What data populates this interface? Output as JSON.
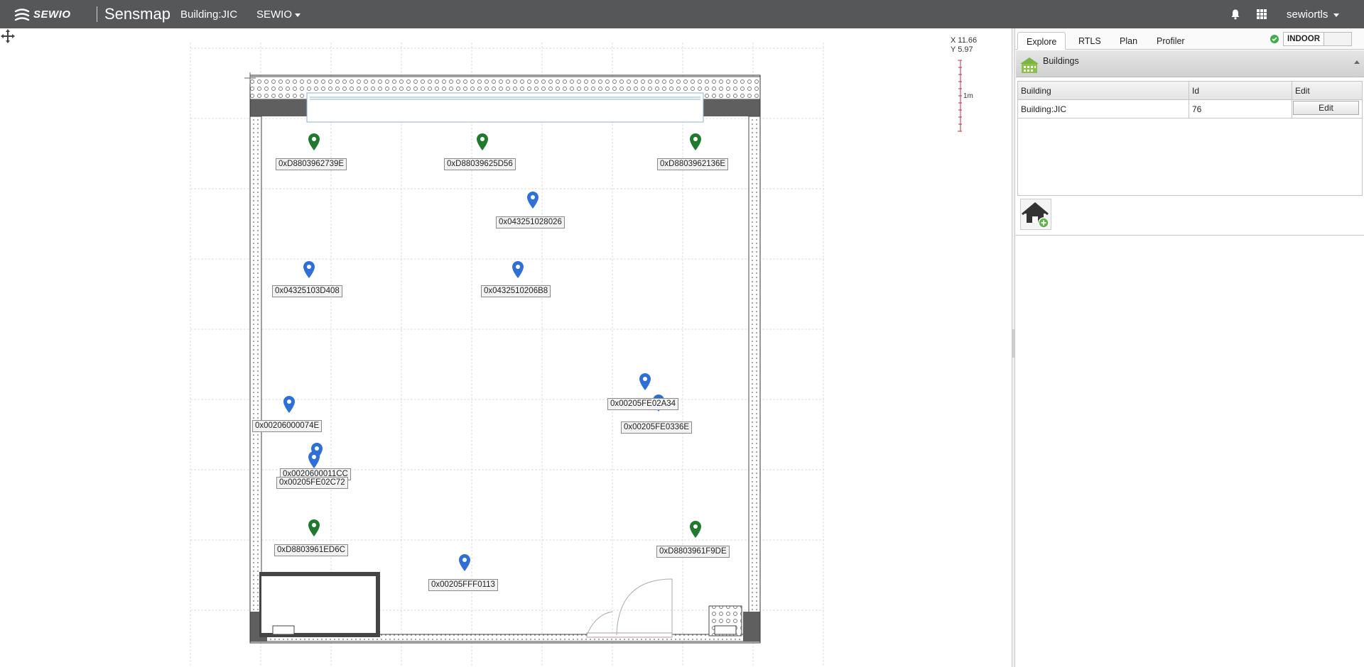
{
  "header": {
    "logo_text": "SEWIO",
    "app_name": "Sensmap",
    "building": "Building:JIC",
    "organization": "SEWIO",
    "user": "sewiortls",
    "icons": [
      "bell-icon",
      "apps-grid-icon",
      "chevron-down-icon"
    ]
  },
  "map": {
    "cursor_coords": {
      "x": "X 11.66",
      "y": "Y 5.97"
    },
    "scale_label": "1m",
    "tags": [
      {
        "id": "0xD8803962739E",
        "type": "anchor"
      },
      {
        "id": "0xD88039625D56",
        "type": "anchor"
      },
      {
        "id": "0xD8803962136E",
        "type": "anchor"
      },
      {
        "id": "0x043251028026",
        "type": "tag"
      },
      {
        "id": "0x04325103D408",
        "type": "tag"
      },
      {
        "id": "0x0432510206B8",
        "type": "tag"
      },
      {
        "id": "0x00205FE02A34",
        "type": "tag"
      },
      {
        "id": "0x00205FE0336E",
        "type": "tag"
      },
      {
        "id": "0x00206000074E",
        "type": "tag"
      },
      {
        "id": "0x0020600011CC",
        "type": "tag"
      },
      {
        "id": "0x00205FE02C72",
        "type": "tag"
      },
      {
        "id": "0xD8803961ED6C",
        "type": "anchor"
      },
      {
        "id": "0xD8803961F9DE",
        "type": "anchor"
      },
      {
        "id": "0x00205FFF0113",
        "type": "tag"
      }
    ],
    "colors": {
      "anchor": "#1f7a2e",
      "tag": "#2f6fd8"
    }
  },
  "panel": {
    "tabs": [
      {
        "label": "Explore",
        "active": true
      },
      {
        "label": "RTLS",
        "active": false
      },
      {
        "label": "Plan",
        "active": false
      },
      {
        "label": "Profiler",
        "active": false
      }
    ],
    "mode": "INDOOR",
    "section_title": "Buildings",
    "table": {
      "headers": [
        "Building",
        "Id",
        "Edit"
      ],
      "rows": [
        {
          "building": "Building:JIC",
          "id": "76",
          "edit": "Edit"
        }
      ]
    },
    "add_button_icon": "add-building-icon"
  }
}
